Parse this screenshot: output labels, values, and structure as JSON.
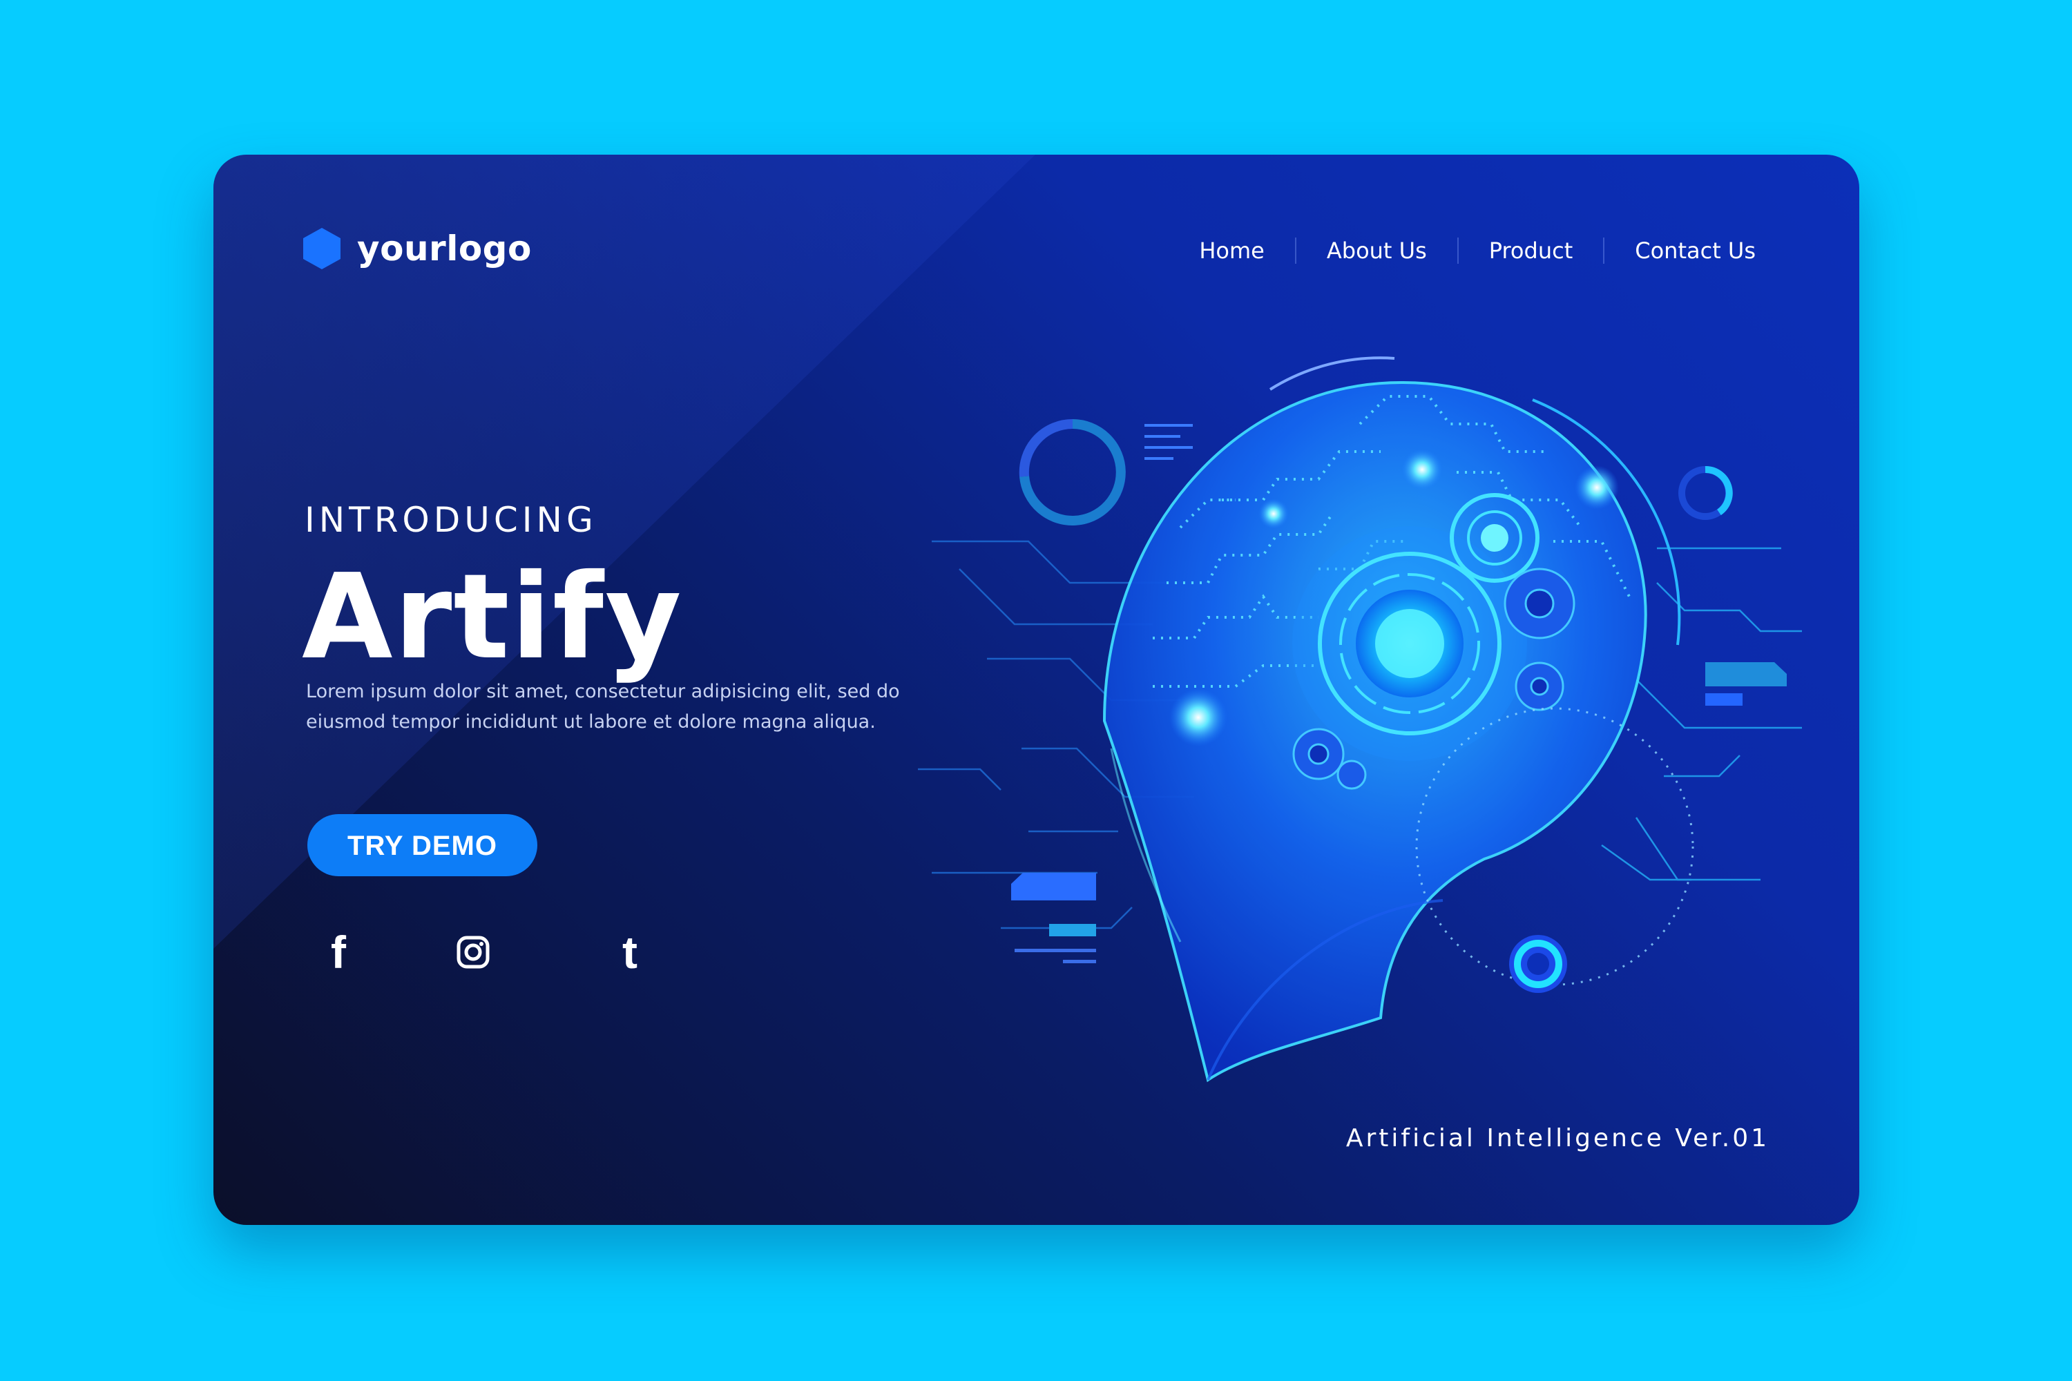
{
  "logo": {
    "text": "yourlogo",
    "icon": "hexagon-icon"
  },
  "nav": {
    "items": [
      {
        "label": "Home"
      },
      {
        "label": "About Us"
      },
      {
        "label": "Product"
      },
      {
        "label": "Contact Us"
      }
    ]
  },
  "hero": {
    "eyebrow": "INTRODUCING",
    "title": "Artify",
    "description": "Lorem ipsum dolor sit amet, consectetur adipisicing elit, sed do eiusmod tempor incididunt ut labore et dolore magna aliqua.",
    "cta_label": "TRY DEMO"
  },
  "social": [
    {
      "icon": "facebook-icon"
    },
    {
      "icon": "instagram-icon"
    },
    {
      "icon": "tumblr-icon"
    }
  ],
  "footer": {
    "version": "Artificial Intelligence Ver.01"
  },
  "colors": {
    "page_background": "#06ccff",
    "card_dark": "#0b0f2a",
    "card_blue": "#0c2fb8",
    "accent": "#0d7df7",
    "logo_hex": "#1a73ff",
    "circuit_cyan": "#22e3ff"
  }
}
